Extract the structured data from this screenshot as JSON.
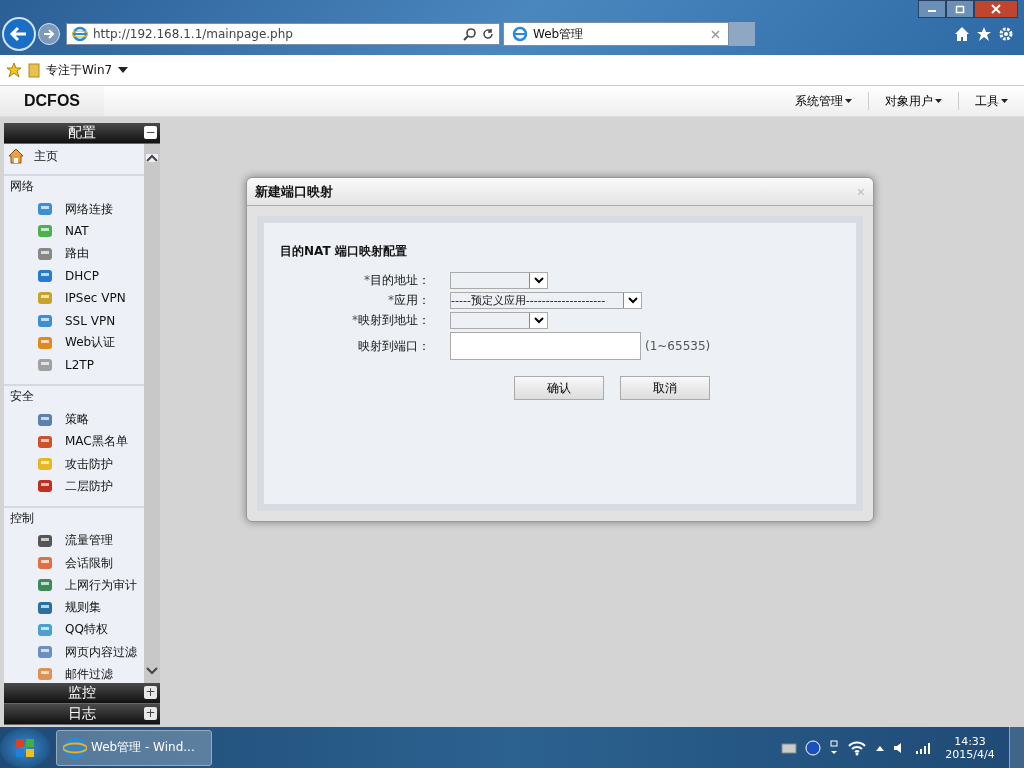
{
  "browser": {
    "address": "http://192.168.1.1/mainpage.php",
    "tab": {
      "title": "Web管理",
      "selected": true
    }
  },
  "favorites": {
    "folder": "专注于Win7"
  },
  "app": {
    "logo": "DCFOS",
    "menus": [
      "系统管理",
      "对象用户",
      "工具"
    ]
  },
  "sidebar": {
    "panels": [
      {
        "title": "配置",
        "expanded": true,
        "toggle": "−"
      },
      {
        "title": "监控",
        "expanded": false,
        "toggle": "+"
      },
      {
        "title": "日志",
        "expanded": false,
        "toggle": "+"
      }
    ],
    "home": "主页",
    "sections": [
      {
        "title": "网络",
        "items": [
          "网络连接",
          "NAT",
          "路由",
          "DHCP",
          "IPSec VPN",
          "SSL VPN",
          "Web认证",
          "L2TP"
        ]
      },
      {
        "title": "安全",
        "items": [
          "策略",
          "MAC黑名单",
          "攻击防护",
          "二层防护"
        ]
      },
      {
        "title": "控制",
        "items": [
          "流量管理",
          "会话限制",
          "上网行为审计",
          "规则集",
          "QQ特权",
          "网页内容过滤",
          "邮件过滤"
        ]
      }
    ]
  },
  "dialog": {
    "title": "新建端口映射",
    "close": "×",
    "heading": "目的NAT 端口映射配置",
    "fields": [
      {
        "kind": "select",
        "mark": "*",
        "label": "目的地址：",
        "wide": false
      },
      {
        "kind": "select",
        "mark": "*",
        "label": "应用：",
        "value": "-----预定义应用--------------------",
        "wide": true
      },
      {
        "kind": "select",
        "mark": "*",
        "label": "映射到地址：",
        "wide": false
      },
      {
        "kind": "text",
        "label": "映射到端口：",
        "hint": "(1~65535)"
      }
    ],
    "buttons": [
      "确认",
      "取消"
    ]
  },
  "taskbar": {
    "window": "Web管理 - Wind...",
    "time": "14:33",
    "date": "2015/4/4"
  }
}
